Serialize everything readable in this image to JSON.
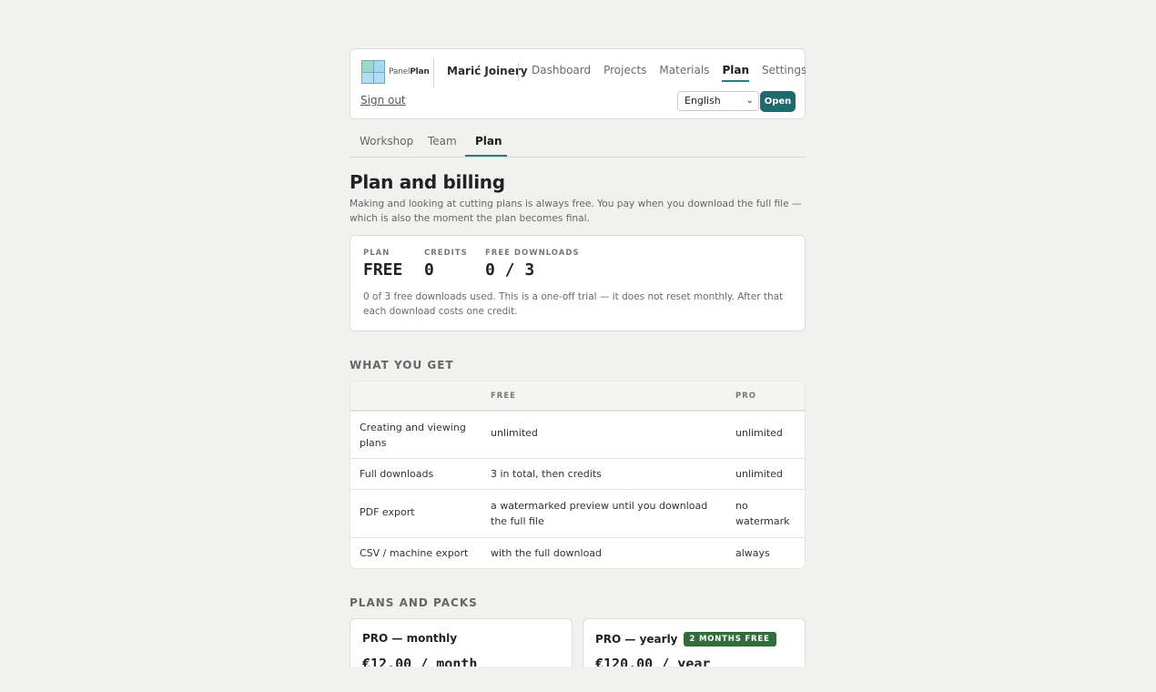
{
  "header": {
    "logo_text_a": "Panel",
    "logo_text_b": "Plan",
    "workspace": "Marić Joinery",
    "nav": [
      "Dashboard",
      "Projects",
      "Materials",
      "Plan",
      "Settings"
    ],
    "nav_active": "Plan",
    "sign_out": "Sign out",
    "language": "English",
    "open_button": "Open"
  },
  "tabs": [
    "Workshop",
    "Team",
    "Plan"
  ],
  "tabs_active": "Plan",
  "page": {
    "title": "Plan and billing",
    "intro": "Making and looking at cutting plans is always free. You pay when you download the full file — which is also the moment the plan becomes final."
  },
  "status": {
    "plan_label": "PLAN",
    "plan_value": "FREE",
    "credits_label": "CREDITS",
    "credits_value": "0",
    "downloads_label": "FREE DOWNLOADS",
    "downloads_value": "0 / 3",
    "note": "0 of 3 free downloads used. This is a one-off trial — it does not reset monthly. After that each download costs one credit."
  },
  "compare": {
    "heading": "WHAT YOU GET",
    "col_free": "FREE",
    "col_pro": "PRO",
    "rows": [
      {
        "feature": "Creating and viewing plans",
        "free": "unlimited",
        "pro": "unlimited"
      },
      {
        "feature": "Full downloads",
        "free": "3 in total, then credits",
        "pro": "unlimited"
      },
      {
        "feature": "PDF export",
        "free": "a watermarked preview until you download the full file",
        "pro": "no watermark"
      },
      {
        "feature": "CSV / machine export",
        "free": "with the full download",
        "pro": "always"
      }
    ]
  },
  "plans": {
    "heading": "PLANS AND PACKS",
    "monthly": {
      "title": "PRO — monthly",
      "price": "€12.00 / month"
    },
    "yearly": {
      "title": "PRO — yearly",
      "badge": "2 MONTHS FREE",
      "price": "€120.00 / year"
    }
  },
  "colors": {
    "accent": "#1f6a6d",
    "badge": "#2f6e3a",
    "background": "#f1f1f0"
  }
}
